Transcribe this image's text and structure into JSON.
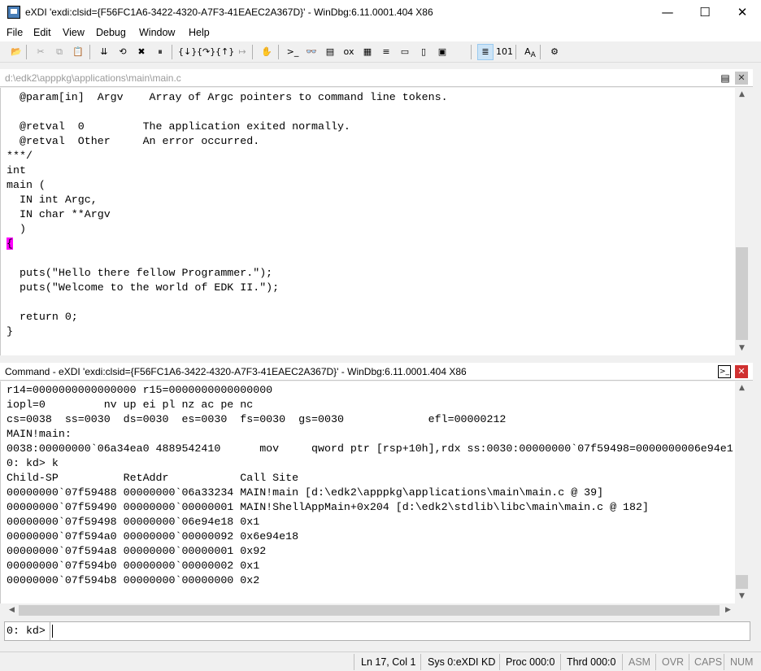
{
  "window": {
    "title": "eXDI 'exdi:clsid={F56FC1A6-3422-4320-A7F3-41EAEC2A367D}' - WinDbg:6.11.0001.404 X86",
    "minimize_glyph": "—",
    "maximize_glyph": "☐",
    "close_glyph": "✕"
  },
  "menu": [
    "File",
    "Edit",
    "View",
    "Debug",
    "Window",
    "Help"
  ],
  "toolbar": {
    "icons": [
      {
        "name": "open-icon",
        "glyph": "📂",
        "disabled": false
      },
      {
        "name": "cut-icon",
        "glyph": "✂",
        "disabled": true
      },
      {
        "name": "copy-icon",
        "glyph": "⧉",
        "disabled": true
      },
      {
        "name": "paste-icon",
        "glyph": "📋",
        "disabled": true
      },
      {
        "name": "go-icon",
        "glyph": "⇊",
        "disabled": false
      },
      {
        "name": "restart-icon",
        "glyph": "⟲",
        "disabled": false
      },
      {
        "name": "stop-debugging-icon",
        "glyph": "✖",
        "disabled": false
      },
      {
        "name": "break-icon",
        "glyph": "⏸",
        "disabled": false
      },
      {
        "name": "step-into-icon",
        "glyph": "{↓}",
        "disabled": false
      },
      {
        "name": "step-over-icon",
        "glyph": "{↷}",
        "disabled": false
      },
      {
        "name": "step-out-icon",
        "glyph": "{↑}",
        "disabled": false
      },
      {
        "name": "run-to-cursor-icon",
        "glyph": "↦",
        "disabled": true
      },
      {
        "name": "breakpoint-hand-icon",
        "glyph": "✋",
        "disabled": false
      },
      {
        "name": "command-window-icon",
        "glyph": ">_",
        "disabled": false
      },
      {
        "name": "watch-window-icon",
        "glyph": "👓",
        "disabled": false
      },
      {
        "name": "locals-window-icon",
        "glyph": "▤",
        "disabled": false
      },
      {
        "name": "registers-window-icon",
        "glyph": "ox",
        "disabled": false
      },
      {
        "name": "memory-window-icon",
        "glyph": "▦",
        "disabled": false
      },
      {
        "name": "call-stack-window-icon",
        "glyph": "≡",
        "disabled": false
      },
      {
        "name": "disassembly-window-icon",
        "glyph": "▭",
        "disabled": false
      },
      {
        "name": "scratch-pad-icon",
        "glyph": "▯",
        "disabled": false
      },
      {
        "name": "processes-threads-icon",
        "glyph": "▣",
        "disabled": false
      },
      {
        "name": "source-mode-icon",
        "glyph": "≣",
        "disabled": false,
        "pressed": true
      },
      {
        "name": "hex-mode-icon",
        "glyph": "101",
        "disabled": false
      },
      {
        "name": "font-icon",
        "glyph": "A<sub>A</sub>",
        "disabled": false
      },
      {
        "name": "options-icon",
        "glyph": "⚙",
        "disabled": false
      }
    ]
  },
  "source": {
    "path": "d:\\edk2\\apppkg\\applications\\main\\main.c",
    "lines": [
      "  @param[in]  Argv    Array of Argc pointers to command line tokens.",
      "",
      "  @retval  0         The application exited normally.",
      "  @retval  Other     An error occurred.",
      "***/",
      "int",
      "main (",
      "  IN int Argc,",
      "  IN char **Argv",
      "  )",
      "{",
      "",
      "  puts(\"Hello there fellow Programmer.\");",
      "  puts(\"Welcome to the world of EDK II.\");",
      "",
      "  return 0;",
      "}"
    ],
    "current_line_index": 10,
    "highlight_color": "#ff00ff"
  },
  "command": {
    "title": "Command - eXDI 'exdi:clsid={F56FC1A6-3422-4320-A7F3-41EAEC2A367D}' - WinDbg:6.11.0001.404 X86",
    "output": [
      "r14=0000000000000000 r15=0000000000000000",
      "iopl=0         nv up ei pl nz ac pe nc",
      "cs=0038  ss=0030  ds=0030  es=0030  fs=0030  gs=0030             efl=00000212",
      "MAIN!main:",
      "0038:00000000`06a34ea0 4889542410      mov     qword ptr [rsp+10h],rdx ss:0030:00000000`07f59498=0000000006e94e1",
      "0: kd> k",
      "Child-SP          RetAddr           Call Site",
      "00000000`07f59488 00000000`06a33234 MAIN!main [d:\\edk2\\apppkg\\applications\\main\\main.c @ 39]",
      "00000000`07f59490 00000000`00000001 MAIN!ShellAppMain+0x204 [d:\\edk2\\stdlib\\libc\\main\\main.c @ 182]",
      "00000000`07f59498 00000000`06e94e18 0x1",
      "00000000`07f594a0 00000000`00000092 0x6e94e18",
      "00000000`07f594a8 00000000`00000001 0x92",
      "00000000`07f594b0 00000000`00000002 0x1",
      "00000000`07f594b8 00000000`00000000 0x2"
    ],
    "prompt": "0: kd>",
    "input_value": ""
  },
  "status": {
    "position": "Ln 17, Col 1",
    "sys": "Sys 0:eXDI KD",
    "proc": "Proc 000:0",
    "thrd": "Thrd 000:0",
    "asm": "ASM",
    "ovr": "OVR",
    "caps": "CAPS",
    "num": "NUM"
  }
}
